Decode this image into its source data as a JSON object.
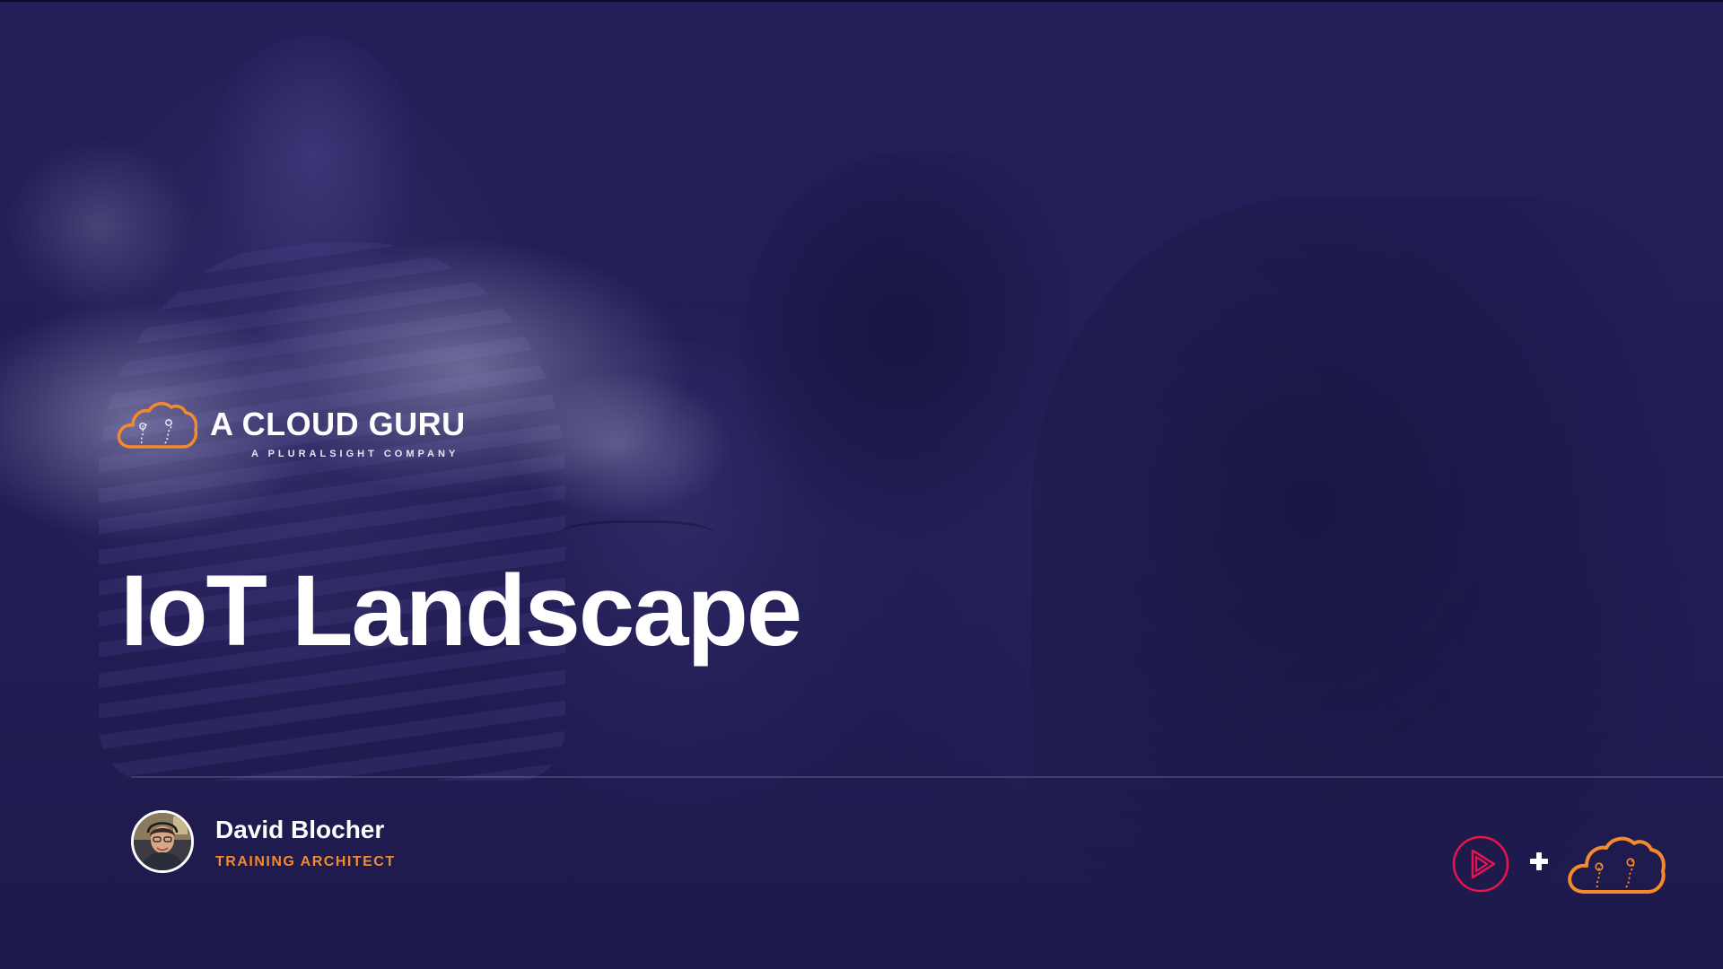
{
  "brand": {
    "name": "A CLOUD GURU",
    "tagline": "A PLURALSIGHT COMPANY",
    "icon": "cloud-logo-icon",
    "accent_color": "#f58a2c"
  },
  "slide": {
    "title": "IoT Landscape",
    "background_color": "#221d55"
  },
  "presenter": {
    "name": "David Blocher",
    "role": "TRAINING ARCHITECT",
    "avatar_icon": "avatar"
  },
  "cobrand": {
    "pluralsight_icon": "pluralsight-play-icon",
    "plus_icon": "plus-icon",
    "acg_icon": "cloud-logo-icon",
    "pluralsight_color": "#e8144e"
  }
}
